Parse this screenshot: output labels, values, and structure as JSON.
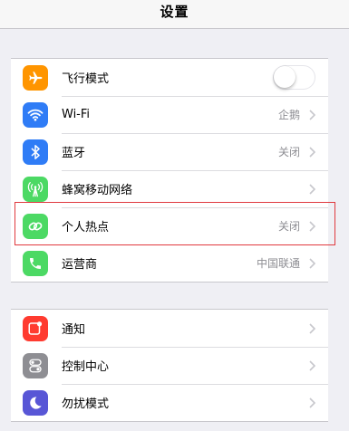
{
  "nav": {
    "title": "设置"
  },
  "group1": [
    {
      "label": "飞行模式",
      "color": "#ff9500",
      "icon": "airplane-icon",
      "toggle": "off"
    },
    {
      "label": "Wi-Fi",
      "value": "企鹅",
      "color": "#2f7cf6",
      "icon": "wifi-icon"
    },
    {
      "label": "蓝牙",
      "value": "关闭",
      "color": "#2f7cf6",
      "icon": "bluetooth-icon"
    },
    {
      "label": "蜂窝移动网络",
      "value": "",
      "color": "#4cd964",
      "icon": "cellular-antenna-icon"
    },
    {
      "label": "个人热点",
      "value": "关闭",
      "color": "#4cd964",
      "icon": "hotspot-link-icon"
    },
    {
      "label": "运营商",
      "value": "中国联通",
      "color": "#4cd964",
      "icon": "phone-icon"
    }
  ],
  "group2": [
    {
      "label": "通知",
      "color": "#ff3b30",
      "icon": "notifications-icon"
    },
    {
      "label": "控制中心",
      "color": "#8e8e93",
      "icon": "control-center-icon"
    },
    {
      "label": "勿扰模式",
      "color": "#5856d6",
      "icon": "moon-icon"
    }
  ]
}
